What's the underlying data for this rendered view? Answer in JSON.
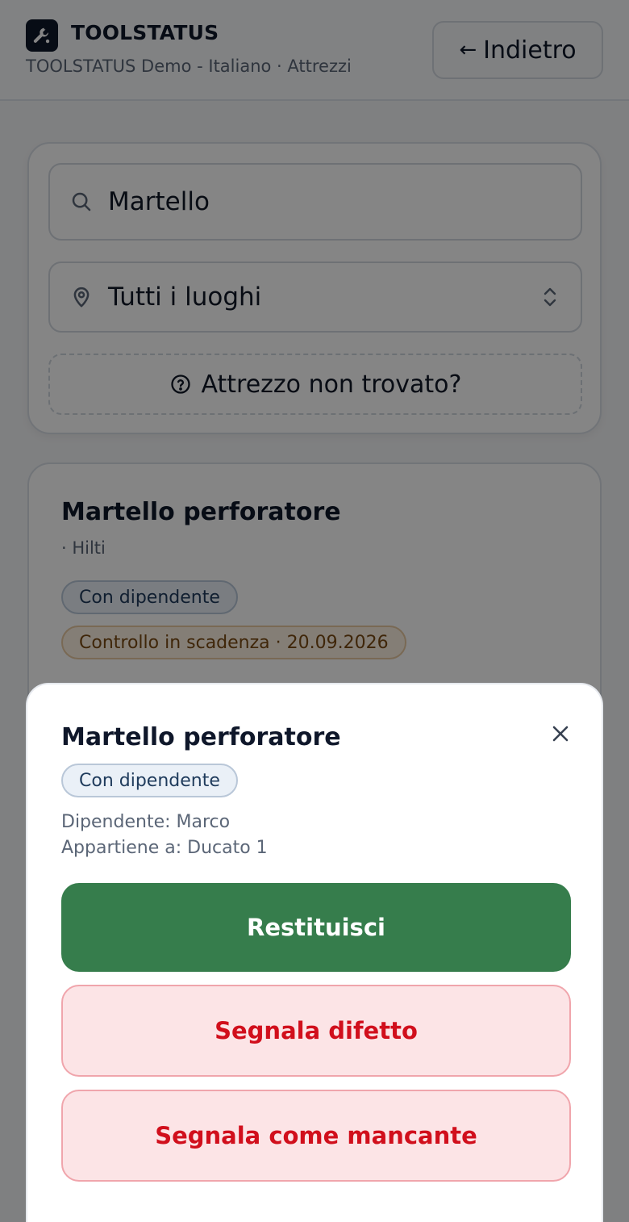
{
  "header": {
    "app_name": "TOOLSTATUS",
    "subtitle": "TOOLSTATUS Demo - Italiano · Attrezzi",
    "back_arrow": "←",
    "back_label": "Indietro",
    "logo_icon": "wrench-icon"
  },
  "search": {
    "query": "Martello",
    "location": "Tutti i luoghi",
    "not_found_label": "Attrezzo non trovato?"
  },
  "tool_card": {
    "name": "Martello perforatore",
    "brand": "· Hilti",
    "status_badge": "Con dipendente",
    "inspection_badge": "Controllo in scadenza · 20.09.2026"
  },
  "sheet": {
    "title": "Martello perforatore",
    "status_badge": "Con dipendente",
    "employee": "Dipendente: Marco",
    "belongs_to": "Appartiene a: Ducato 1",
    "return_label": "Restituisci",
    "defect_label": "Segnala difetto",
    "missing_label": "Segnala come mancante"
  },
  "colors": {
    "primary": "#367d4c",
    "danger": "#d10f1c",
    "danger_bg": "#fce4e6"
  }
}
